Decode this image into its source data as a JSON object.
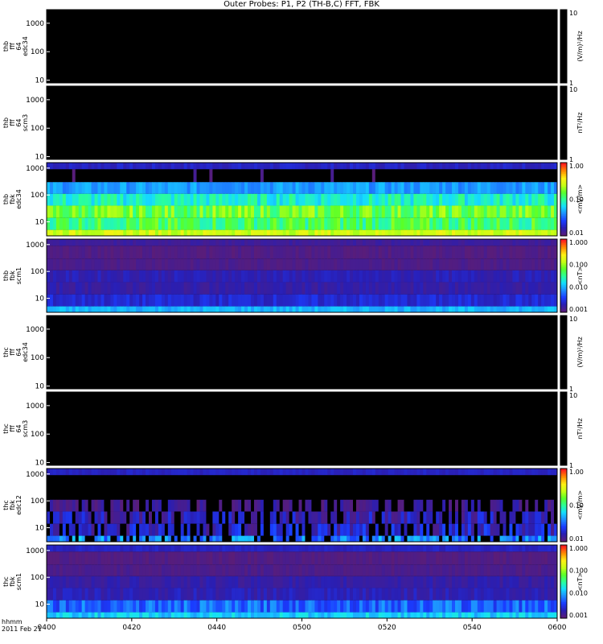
{
  "page": {
    "title": "Outer Probes: P1, P2 (TH-B,C) FFT, FBK",
    "time_label": "hhmm",
    "date_label": "2011 Feb 21"
  },
  "colors": {
    "background": "#000000",
    "colorscale": [
      "#5a1d78",
      "#2a1eb2",
      "#1a3cff",
      "#1e8cff",
      "#14dcff",
      "#2aff9a",
      "#5aff28",
      "#c8ff14",
      "#fff014",
      "#ff8c00",
      "#ff1e1e"
    ]
  },
  "chart_data": [
    {
      "type": "heatmap",
      "probe": "thb",
      "product": "fff",
      "channel": "64",
      "sensor": "edc34",
      "yticks": [
        "1000",
        "100",
        "10"
      ],
      "ylim": [
        8,
        3000
      ],
      "yscale": "log",
      "colorbar": {
        "ticks": [
          "10",
          "1"
        ],
        "label": "(V/m)²/Hz"
      },
      "pattern": "empty"
    },
    {
      "type": "heatmap",
      "probe": "thb",
      "product": "fff",
      "channel": "64",
      "sensor": "scm3",
      "yticks": [
        "1000",
        "100",
        "10"
      ],
      "ylim": [
        8,
        3000
      ],
      "yscale": "log",
      "colorbar": {
        "ticks": [
          "10",
          "1"
        ],
        "label": "nT²/Hz"
      },
      "pattern": "empty"
    },
    {
      "type": "heatmap",
      "probe": "thb",
      "product": "fbk",
      "channel": "",
      "sensor": "edc34",
      "yticks": [
        "1000",
        "100",
        "10"
      ],
      "ylim": [
        3,
        1600
      ],
      "yscale": "log",
      "colorbar": {
        "ticks": [
          "1.00",
          "0.10",
          "0.01"
        ],
        "label": "<mV/m>"
      },
      "pattern": "fbk_e_b",
      "bands": [
        {
          "f_low": 900,
          "f_high": 1600,
          "level": 0.12,
          "var": 0.03
        },
        {
          "f_low": 300,
          "f_high": 900,
          "level": 0.0,
          "var": 0.06
        },
        {
          "f_low": 110,
          "f_high": 300,
          "level": 0.32,
          "var": 0.05
        },
        {
          "f_low": 40,
          "f_high": 110,
          "level": 0.45,
          "var": 0.08
        },
        {
          "f_low": 14,
          "f_high": 40,
          "level": 0.6,
          "var": 0.1
        },
        {
          "f_low": 5,
          "f_high": 14,
          "level": 0.55,
          "var": 0.1
        },
        {
          "f_low": 3,
          "f_high": 5,
          "level": 0.72,
          "var": 0.06
        }
      ]
    },
    {
      "type": "heatmap",
      "probe": "thb",
      "product": "fbk",
      "channel": "",
      "sensor": "scm1",
      "yticks": [
        "1000",
        "100",
        "10"
      ],
      "ylim": [
        3,
        1600
      ],
      "yscale": "log",
      "colorbar": {
        "ticks": [
          "1.000",
          "0.100",
          "0.010",
          "0.001"
        ],
        "label": "<nT>"
      },
      "pattern": "fbk_b",
      "bands": [
        {
          "f_low": 900,
          "f_high": 1600,
          "level": 0.06,
          "var": 0.02
        },
        {
          "f_low": 300,
          "f_high": 900,
          "level": 0.02,
          "var": 0.02
        },
        {
          "f_low": 110,
          "f_high": 300,
          "level": 0.03,
          "var": 0.02
        },
        {
          "f_low": 40,
          "f_high": 110,
          "level": 0.1,
          "var": 0.03
        },
        {
          "f_low": 14,
          "f_high": 40,
          "level": 0.08,
          "var": 0.03
        },
        {
          "f_low": 5,
          "f_high": 14,
          "level": 0.14,
          "var": 0.04
        },
        {
          "f_low": 3,
          "f_high": 5,
          "level": 0.35,
          "var": 0.04
        }
      ]
    },
    {
      "type": "heatmap",
      "probe": "thc",
      "product": "fff",
      "channel": "64",
      "sensor": "edc34",
      "yticks": [
        "1000",
        "100",
        "10"
      ],
      "ylim": [
        8,
        3000
      ],
      "yscale": "log",
      "colorbar": {
        "ticks": [
          "10",
          "1"
        ],
        "label": "(V/m)²/Hz"
      },
      "pattern": "empty"
    },
    {
      "type": "heatmap",
      "probe": "thc",
      "product": "fff",
      "channel": "64",
      "sensor": "scm3",
      "yticks": [
        "1000",
        "100",
        "10"
      ],
      "ylim": [
        8,
        3000
      ],
      "yscale": "log",
      "colorbar": {
        "ticks": [
          "10",
          "1"
        ],
        "label": "nT²/Hz"
      },
      "pattern": "empty"
    },
    {
      "type": "heatmap",
      "probe": "thc",
      "product": "fbk",
      "channel": "",
      "sensor": "edc12",
      "yticks": [
        "1000",
        "100",
        "10"
      ],
      "ylim": [
        3,
        1600
      ],
      "yscale": "log",
      "colorbar": {
        "ticks": [
          "1.00",
          "0.10",
          "0.01"
        ],
        "label": "<mV/m>"
      },
      "pattern": "fbk_e_c",
      "bands": [
        {
          "f_low": 900,
          "f_high": 1600,
          "level": 0.12,
          "var": 0.02
        },
        {
          "f_low": 300,
          "f_high": 900,
          "level": -1,
          "var": 0.0
        },
        {
          "f_low": 110,
          "f_high": 300,
          "level": -1,
          "var": 0.0
        },
        {
          "f_low": 40,
          "f_high": 110,
          "level": 0.04,
          "var": 0.06
        },
        {
          "f_low": 14,
          "f_high": 40,
          "level": 0.1,
          "var": 0.08
        },
        {
          "f_low": 5,
          "f_high": 14,
          "level": 0.12,
          "var": 0.1
        },
        {
          "f_low": 3,
          "f_high": 5,
          "level": 0.3,
          "var": 0.1
        }
      ]
    },
    {
      "type": "heatmap",
      "probe": "thc",
      "product": "fbk",
      "channel": "",
      "sensor": "scm1",
      "yticks": [
        "1000",
        "100",
        "10"
      ],
      "ylim": [
        3,
        1600
      ],
      "yscale": "log",
      "colorbar": {
        "ticks": [
          "1.000",
          "0.100",
          "0.010",
          "0.001"
        ],
        "label": "<nT>"
      },
      "pattern": "fbk_b_c",
      "bands": [
        {
          "f_low": 900,
          "f_high": 1600,
          "level": 0.12,
          "var": 0.02
        },
        {
          "f_low": 300,
          "f_high": 900,
          "level": 0.02,
          "var": 0.02
        },
        {
          "f_low": 110,
          "f_high": 300,
          "level": 0.03,
          "var": 0.02
        },
        {
          "f_low": 40,
          "f_high": 110,
          "level": 0.08,
          "var": 0.03
        },
        {
          "f_low": 14,
          "f_high": 40,
          "level": 0.1,
          "var": 0.04
        },
        {
          "f_low": 5,
          "f_high": 14,
          "level": 0.25,
          "var": 0.08
        },
        {
          "f_low": 3,
          "f_high": 5,
          "level": 0.38,
          "var": 0.06
        }
      ]
    }
  ],
  "x_axis": {
    "ticks": [
      "0400",
      "0420",
      "0440",
      "0500",
      "0520",
      "0540",
      "0600"
    ],
    "xlim": [
      "0400",
      "0600"
    ]
  }
}
